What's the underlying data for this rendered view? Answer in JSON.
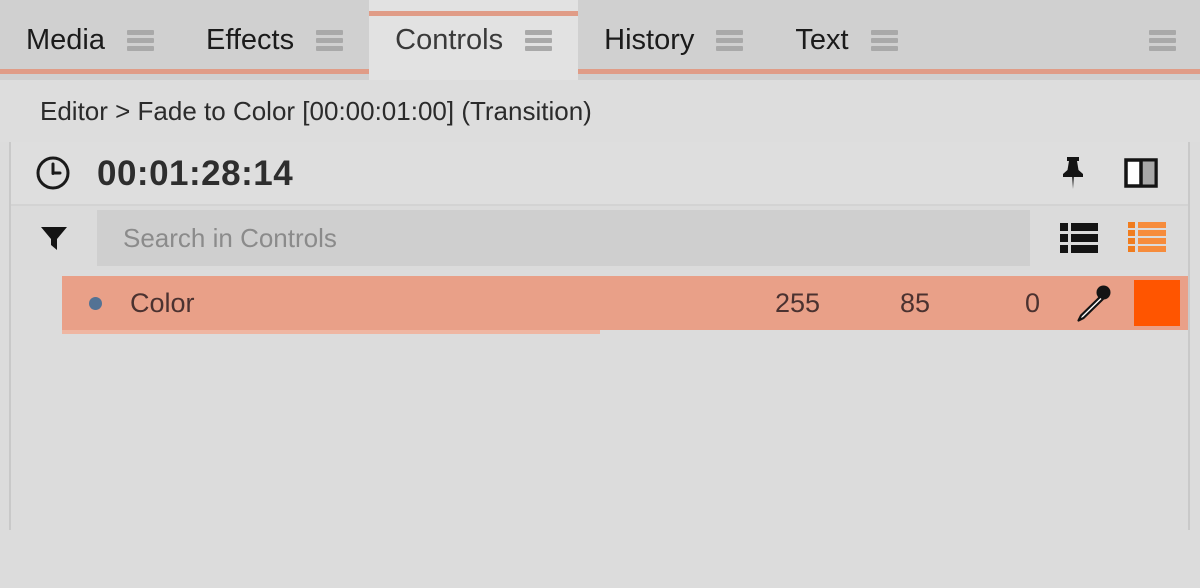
{
  "tabs": [
    {
      "label": "Media",
      "active": false,
      "menu_icon": "hamburger-icon"
    },
    {
      "label": "Effects",
      "active": false,
      "menu_icon": "hamburger-icon"
    },
    {
      "label": "Controls",
      "active": true,
      "menu_icon": "hamburger-icon"
    },
    {
      "label": "History",
      "active": false,
      "menu_icon": "hamburger-icon"
    },
    {
      "label": "Text",
      "active": false,
      "menu_icon": "hamburger-icon"
    }
  ],
  "tabbar": {
    "overflow_menu_icon": "hamburger-icon",
    "accent_color": "#e09c87"
  },
  "breadcrumb": {
    "text": "Editor > Fade to Color [00:00:01:00] (Transition)"
  },
  "timecode": {
    "clock_icon": "clock-icon",
    "value": "00:01:28:14",
    "pin_icon": "pin-icon",
    "split_view_icon": "split-panel-icon"
  },
  "search": {
    "filter_icon": "funnel-icon",
    "placeholder": "Search in Controls",
    "value": "",
    "list_view_icon": "list-view-icon",
    "detail_view_icon": "detail-list-view-icon",
    "detail_view_color": "#f07c1e"
  },
  "controls": {
    "rows": [
      {
        "name": "Color",
        "selected": true,
        "row_color": "#e9a088",
        "values": [
          "255",
          "85",
          "0"
        ],
        "eyedropper_icon": "eyedropper-icon",
        "swatch_icon": "color-swatch",
        "swatch_color": "#ff5500"
      }
    ]
  }
}
